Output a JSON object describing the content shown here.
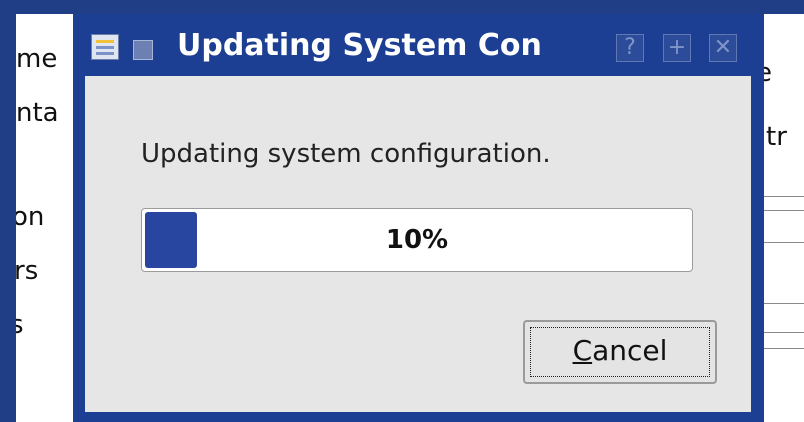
{
  "background_window": {
    "left_fragments": [
      "me",
      "nta",
      "on",
      "rs",
      "s"
    ],
    "right_fragments": [
      "ee",
      "tr"
    ]
  },
  "dialog": {
    "title": "Updating System Con",
    "title_buttons": {
      "help_glyph": "?",
      "maximize_glyph": "+",
      "close_glyph": "✕"
    },
    "icons": {
      "app": "configuration-app-icon",
      "window_menu": "window-menu-icon"
    },
    "message": "Updating system configuration.",
    "progress": {
      "percent": 10,
      "label": "10%"
    },
    "cancel_button": {
      "mnemonic": "C",
      "rest": "ancel"
    }
  },
  "colors": {
    "desktop": "#1f3e86",
    "titlebar": "#1d3f93",
    "dialog_body": "#e6e6e6",
    "progress_fill": "#2846a0"
  }
}
